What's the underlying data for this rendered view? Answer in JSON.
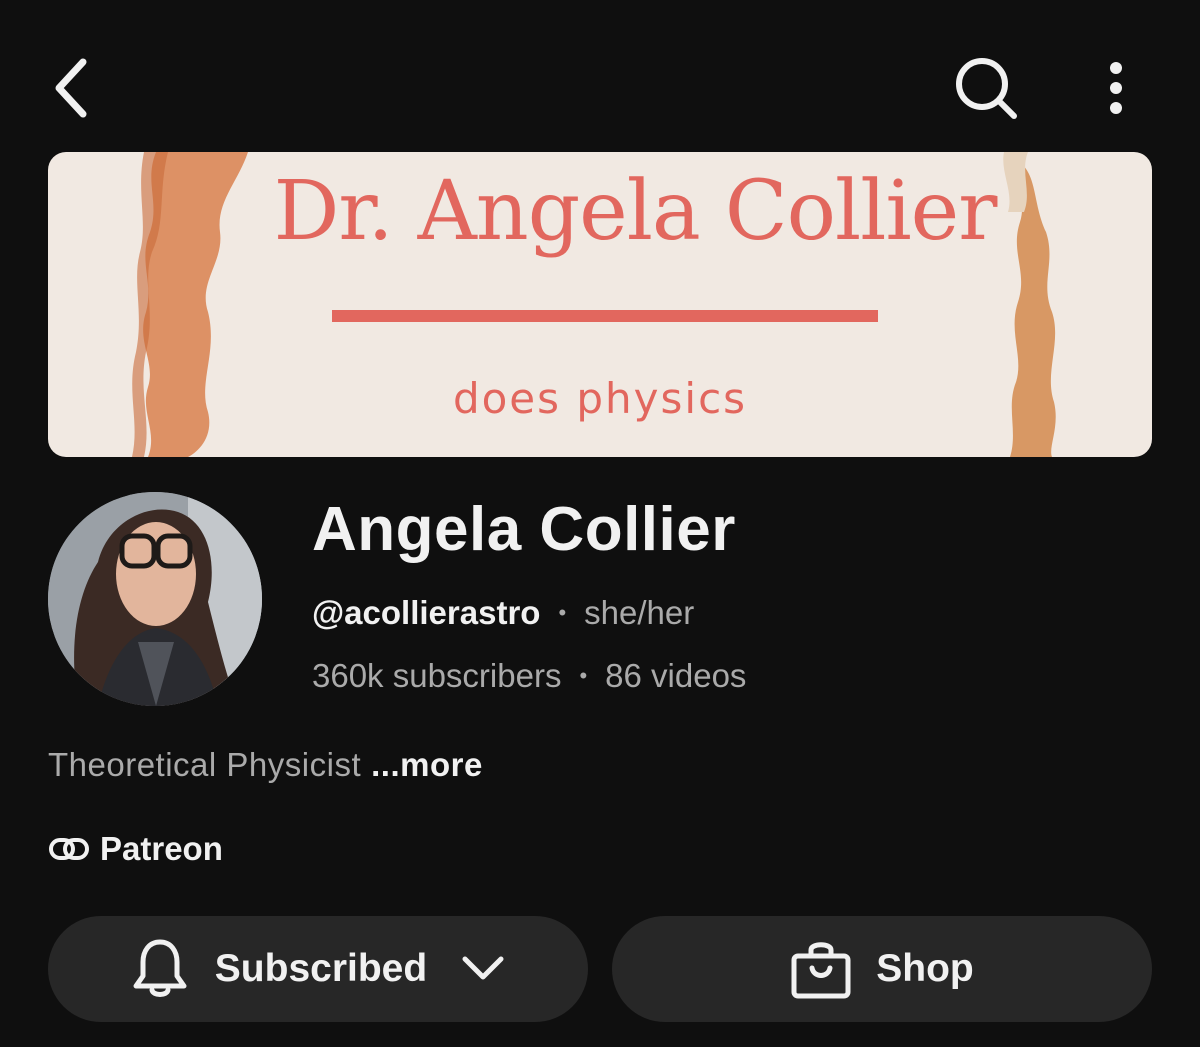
{
  "topbar": {
    "back_icon": "chevron-left-icon",
    "search_icon": "search-icon",
    "more_icon": "more-vertical-icon"
  },
  "banner": {
    "title": "Dr. Angela Collier",
    "subtitle": "does physics",
    "accent_color": "#e2675e",
    "background_color": "#f1e9e2"
  },
  "channel": {
    "name": "Angela Collier",
    "handle": "@acollierastro",
    "pronouns": "she/her",
    "separator": "•",
    "subscribers": "360k subscribers",
    "videos": "86 videos",
    "description": "Theoretical Physicist",
    "more_label": "...more",
    "link_label": "Patreon",
    "link_icon": "link-icon"
  },
  "actions": {
    "subscribed_label": "Subscribed",
    "subscribed_icon": "bell-icon",
    "subscribed_dropdown_icon": "chevron-down-icon",
    "shop_label": "Shop",
    "shop_icon": "shopping-bag-icon"
  },
  "colors": {
    "background": "#0f0f0f",
    "button_background": "#272727",
    "primary_text": "#f1f1f1",
    "secondary_text": "#aaaaaa"
  }
}
